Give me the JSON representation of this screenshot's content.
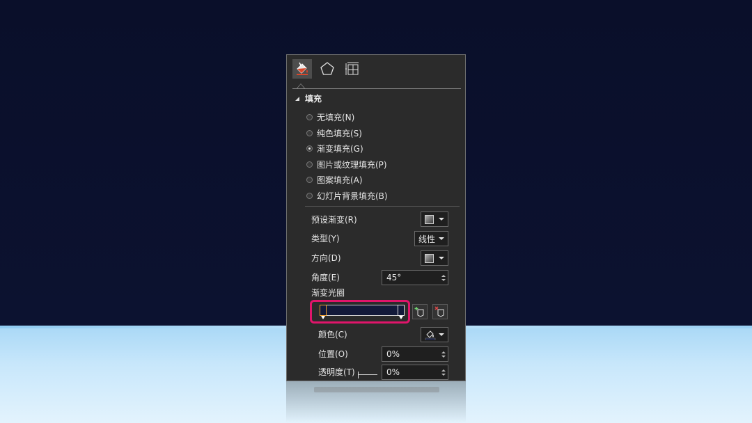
{
  "tabs": [
    {
      "name": "fill-line",
      "icon": "paint-bucket-icon"
    },
    {
      "name": "effects",
      "icon": "pentagon-icon"
    },
    {
      "name": "size-properties",
      "icon": "size-grid-icon"
    }
  ],
  "section": {
    "title": "填充"
  },
  "fill_options": [
    {
      "label": "无填充(N)",
      "checked": false
    },
    {
      "label": "纯色填充(S)",
      "checked": false
    },
    {
      "label": "渐变填充(G)",
      "checked": true
    },
    {
      "label": "图片或纹理填充(P)",
      "checked": false
    },
    {
      "label": "图案填充(A)",
      "checked": false
    },
    {
      "label": "幻灯片背景填充(B)",
      "checked": false
    }
  ],
  "gradient": {
    "preset_label": "预设渐变(R)",
    "type_label": "类型(Y)",
    "type_value": "线性",
    "direction_label": "方向(D)",
    "angle_label": "角度(E)",
    "angle_value": "45°",
    "stops_label": "渐变光圈",
    "color_label": "颜色(C)",
    "position_label": "位置(O)",
    "position_value": "0%",
    "transparency_label": "透明度(T)",
    "transparency_value": "0%"
  },
  "colors": {
    "highlight": "#e0156b",
    "selected_stop": "#f0a030",
    "gradient_color": "#131a3a"
  }
}
